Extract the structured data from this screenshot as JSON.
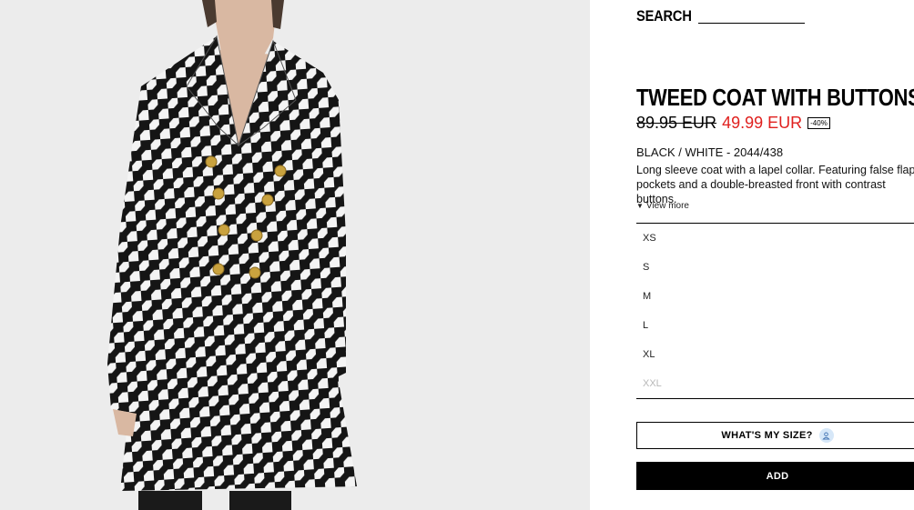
{
  "product_image": {
    "alt": "",
    "colors": {
      "background": "#ececec",
      "skin": "#d9b8a2",
      "coat_dark": "#151515",
      "coat_light": "#f4f4f4",
      "buttons": "#c9a23e",
      "boots": "#1a1a1a"
    }
  },
  "search": {
    "label": "SEARCH",
    "placeholder": "",
    "value": ""
  },
  "product": {
    "title": "TWEED COAT WITH BUTTONS",
    "old_price": "89.95 EUR",
    "new_price": "49.99 EUR",
    "discount": "-40%",
    "color_code": "BLACK / WHITE - 2044/438",
    "description": "Long sleeve coat with a lapel collar. Featuring false flap pockets and a double-breasted front with contrast buttons.",
    "view_more": "View more"
  },
  "sizes": [
    {
      "label": "XS",
      "available": true
    },
    {
      "label": "S",
      "available": true
    },
    {
      "label": "M",
      "available": true
    },
    {
      "label": "L",
      "available": true
    },
    {
      "label": "XL",
      "available": true
    },
    {
      "label": "XXL",
      "available": false
    }
  ],
  "actions": {
    "size_guide": "WHAT'S MY SIZE?",
    "add": "ADD"
  },
  "colors": {
    "sale_price": "#e0201e",
    "accent_bg": "#000000",
    "unavailable": "#b8b8b8",
    "size_help_icon_bg": "#d6e7f8"
  }
}
